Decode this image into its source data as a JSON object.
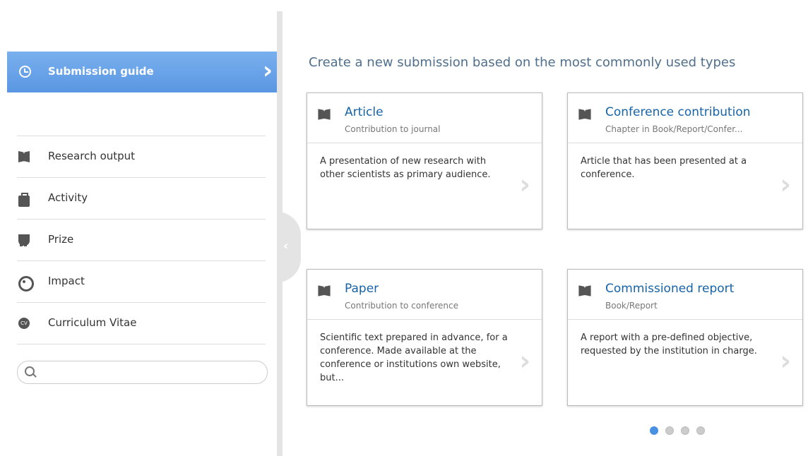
{
  "sidebar": {
    "submission_guide": "Submission guide",
    "items": [
      {
        "label": "Research output",
        "icon": "book-icon"
      },
      {
        "label": "Activity",
        "icon": "briefcase-icon"
      },
      {
        "label": "Prize",
        "icon": "trophy-icon"
      },
      {
        "label": "Impact",
        "icon": "target-icon"
      },
      {
        "label": "Curriculum Vitae",
        "icon": "cv-icon"
      }
    ],
    "search": {
      "placeholder": ""
    }
  },
  "main": {
    "heading": "Create a new submission based on the most commonly used types",
    "cards": [
      {
        "title": "Article",
        "subtitle": "Contribution to journal",
        "description": "A presentation of new research with other scientists as primary audience."
      },
      {
        "title": "Conference contribution",
        "subtitle": "Chapter in Book/Report/Confer...",
        "description": "Article that has been presented at a conference."
      },
      {
        "title": "Paper",
        "subtitle": "Contribution to conference",
        "description": "Scientific text prepared in advance, for a conference. Made available at the conference or institutions own website, but..."
      },
      {
        "title": "Commissioned report",
        "subtitle": "Book/Report",
        "description": "A report with a pre-defined objective, requested by the institution in charge."
      }
    ],
    "pagination": {
      "pages": 4,
      "active": 1
    }
  },
  "colors": {
    "accent": "#5a96e2",
    "title": "#1763a8"
  }
}
